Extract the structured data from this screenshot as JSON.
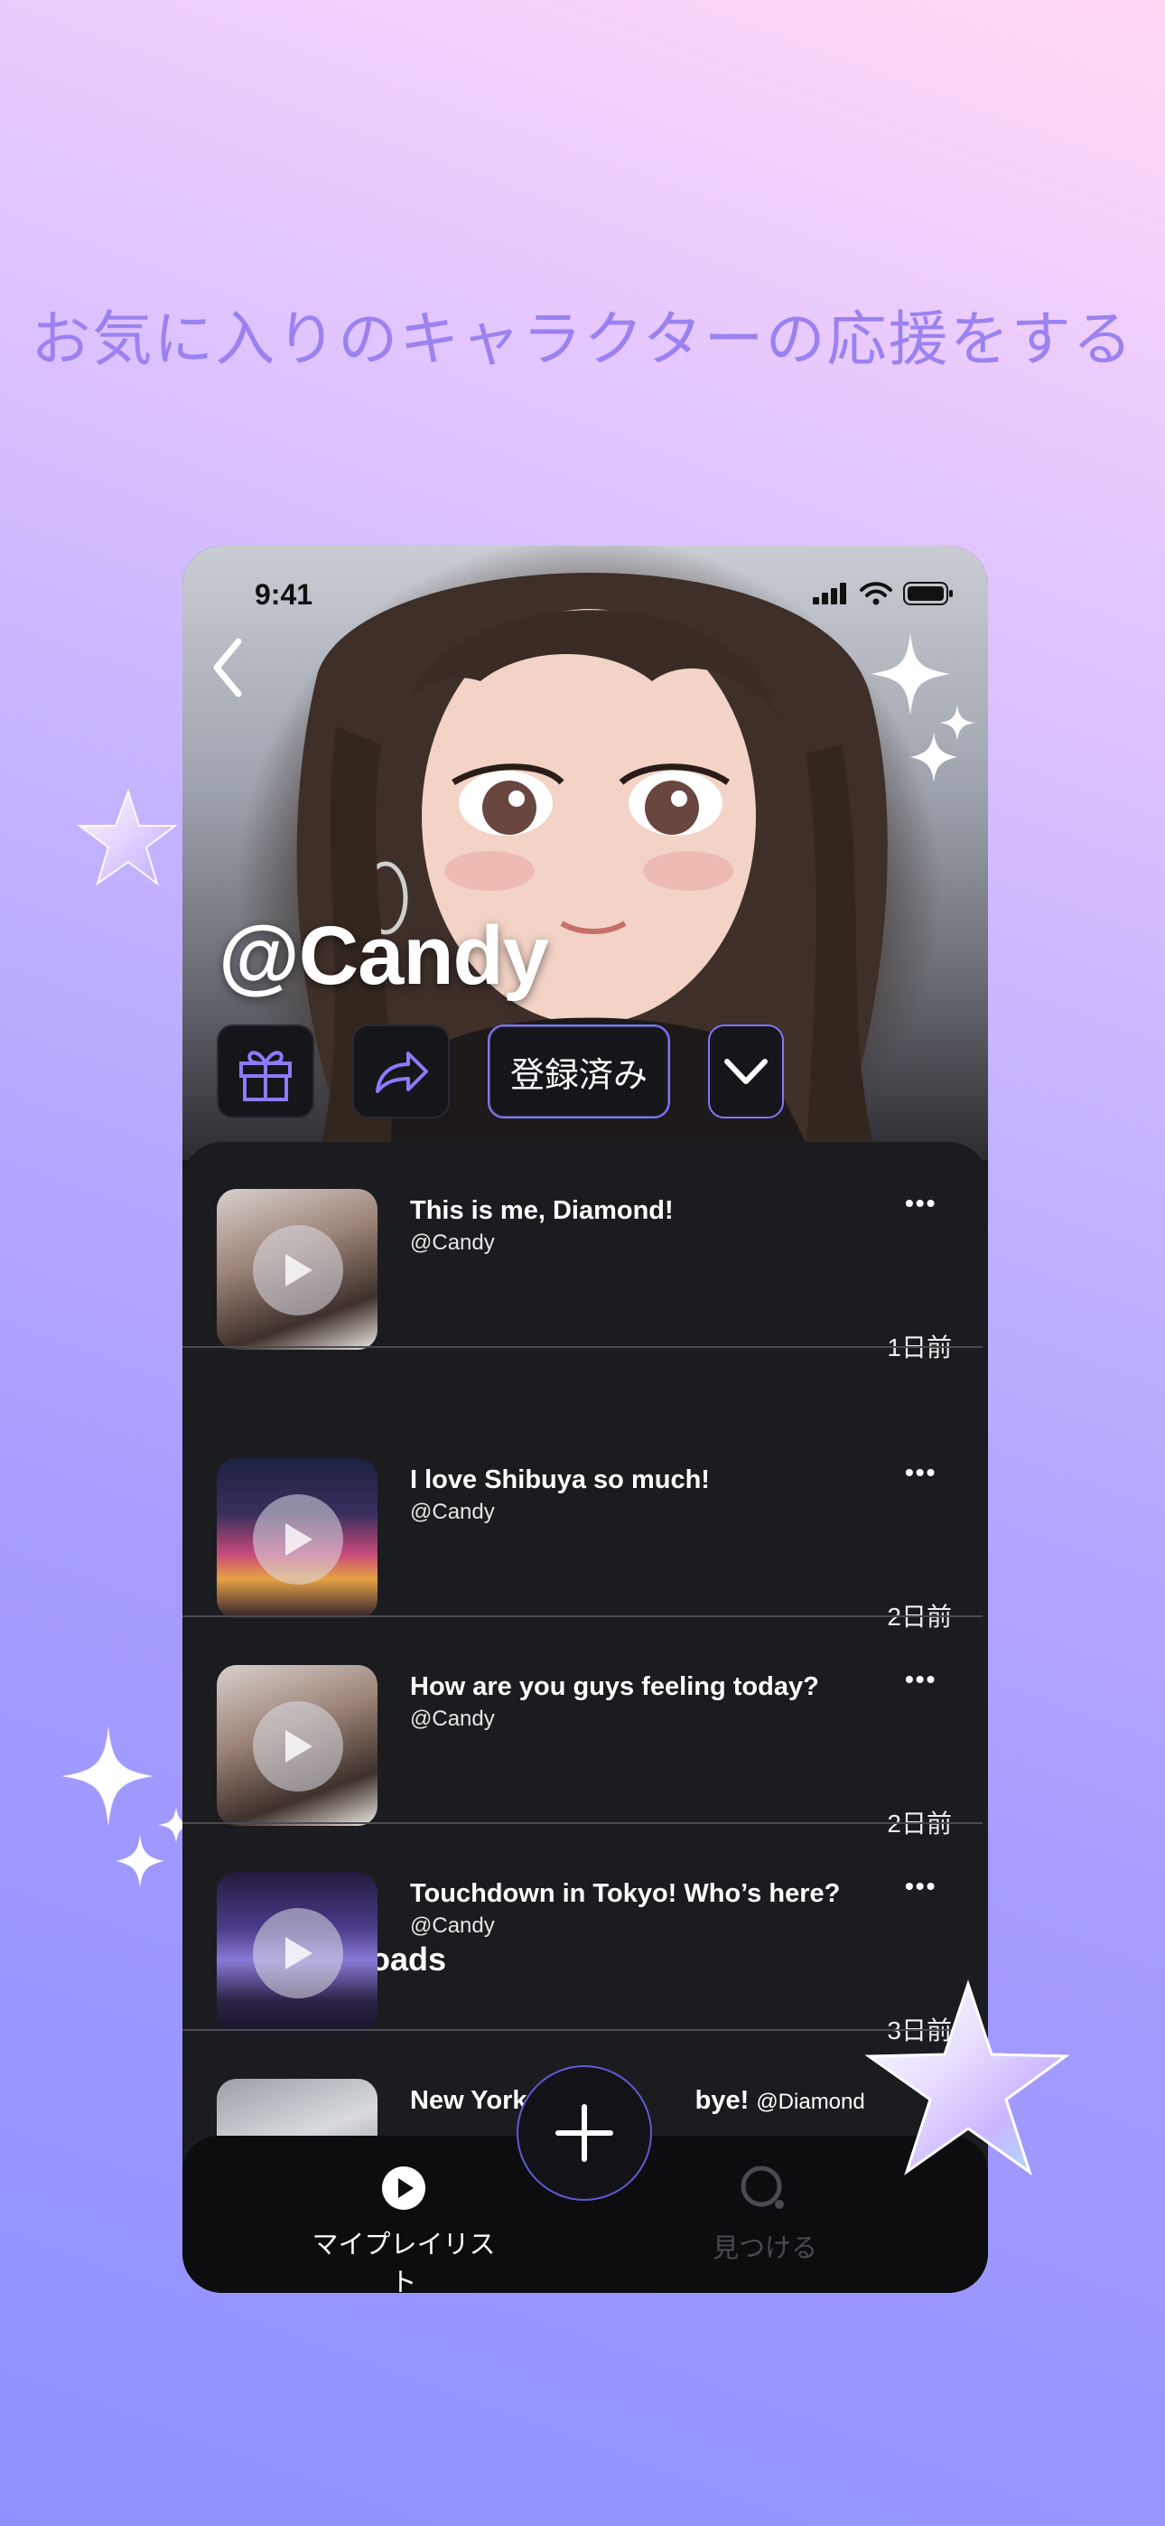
{
  "headline": "お気に入りのキャラクターの応援をする",
  "status_bar": {
    "time": "9:41"
  },
  "profile": {
    "name": "@Candy"
  },
  "actions": {
    "subscribe_label": "登録済み"
  },
  "featured": {
    "title": "This is me, Diamond!",
    "user": "@Candy",
    "age": "1日前",
    "more": "•••"
  },
  "latest_uploads": {
    "title": "Latest uploads",
    "items": [
      {
        "title": "I love Shibuya so much!",
        "user": "@Candy",
        "age": "2日前",
        "more": "•••"
      },
      {
        "title": "How are you guys feeling today?",
        "user": "@Candy",
        "age": "2日前",
        "more": "•••"
      },
      {
        "title": "Touchdown in Tokyo! Who’s here?",
        "user": "@Candy",
        "age": "3日前",
        "more": "•••"
      },
      {
        "title": "New York",
        "title_end": "bye!",
        "user": "@Diamond"
      }
    ]
  },
  "bottom_nav": {
    "items": [
      {
        "label": "マイプレイリスト",
        "icon": "play-circle-icon",
        "active": true
      },
      {
        "label": "見つける",
        "icon": "search-icon",
        "active": false
      }
    ],
    "fab_icon": "plus-icon"
  },
  "colors": {
    "accent": "#8474ff",
    "headline": "#9b82f0",
    "panel": "#1b1c1f"
  }
}
